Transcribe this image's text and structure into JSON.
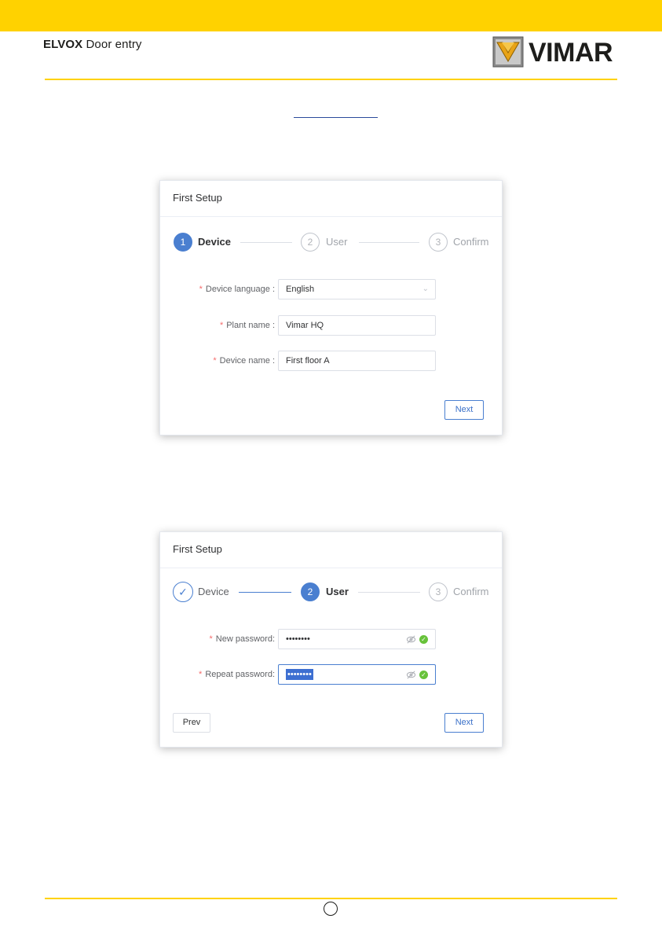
{
  "header": {
    "brand_bold": "ELVOX",
    "brand_rest": " Door entry",
    "logo_text": "VIMAR"
  },
  "colors": {
    "header_yellow": "#ffd200",
    "accent_blue": "#4a7fd0",
    "success_green": "#67c23a",
    "required_red": "#f56c6c"
  },
  "dialog1": {
    "title": "First Setup",
    "steps": [
      {
        "number": "1",
        "label": "Device",
        "status": "active"
      },
      {
        "number": "2",
        "label": "User",
        "status": "wait"
      },
      {
        "number": "3",
        "label": "Confirm",
        "status": "wait"
      }
    ],
    "fields": [
      {
        "label": "Device language",
        "value": "English",
        "type": "select"
      },
      {
        "label": "Plant name",
        "value": "Vimar HQ",
        "type": "text"
      },
      {
        "label": "Device name",
        "value": "First floor A",
        "type": "text"
      }
    ],
    "required_mark": "*",
    "label_suffix": ":",
    "next_label": "Next"
  },
  "dialog2": {
    "title": "First Setup",
    "steps": [
      {
        "number": "✓",
        "label": "Device",
        "status": "done"
      },
      {
        "number": "2",
        "label": "User",
        "status": "active"
      },
      {
        "number": "3",
        "label": "Confirm",
        "status": "wait"
      }
    ],
    "fields": [
      {
        "label": "New password",
        "value": "••••••••",
        "type": "password",
        "valid": true
      },
      {
        "label": "Repeat password",
        "value": "••••••••",
        "type": "password",
        "valid": true,
        "selected": true
      }
    ],
    "required_mark": "*",
    "label_suffix": ":",
    "prev_label": "Prev",
    "next_label": "Next"
  }
}
